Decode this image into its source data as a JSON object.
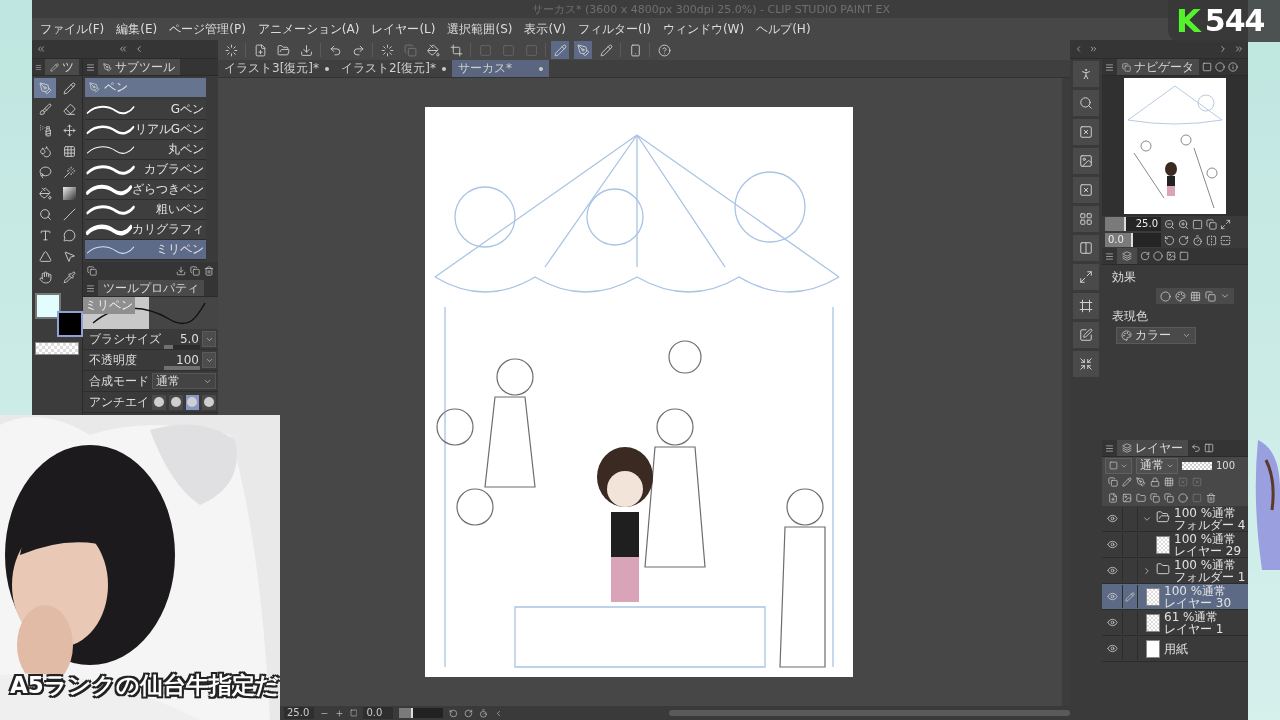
{
  "window": {
    "title": "サーカス* (3600 x 4800px 300dpi 25.0%) - CLIP STUDIO PAINT EX"
  },
  "menu": [
    "ファイル(F)",
    "編集(E)",
    "ページ管理(P)",
    "アニメーション(A)",
    "レイヤー(L)",
    "選択範囲(S)",
    "表示(V)",
    "フィルター(I)",
    "ウィンドウ(W)",
    "ヘルプ(H)"
  ],
  "tool_palette": {
    "tab": "ツ",
    "tools": [
      {
        "kind": "pen",
        "selected": true
      },
      {
        "kind": "pencil",
        "selected": false
      },
      {
        "kind": "brush",
        "selected": false
      },
      {
        "kind": "eraser",
        "selected": false
      },
      {
        "kind": "spray",
        "selected": false
      },
      {
        "kind": "move",
        "selected": false
      },
      {
        "kind": "blend",
        "selected": false
      },
      {
        "kind": "figure",
        "selected": false
      },
      {
        "kind": "lasso",
        "selected": false
      },
      {
        "kind": "wand",
        "selected": false
      },
      {
        "kind": "fill",
        "selected": false
      },
      {
        "kind": "gradient",
        "selected": false
      },
      {
        "kind": "operation",
        "selected": false
      },
      {
        "kind": "line",
        "selected": false
      },
      {
        "kind": "text",
        "selected": false
      },
      {
        "kind": "balloon",
        "selected": false
      },
      {
        "kind": "ruler",
        "selected": false
      },
      {
        "kind": "correct",
        "selected": false
      },
      {
        "kind": "hand",
        "selected": false
      },
      {
        "kind": "eyedropper",
        "selected": false
      }
    ],
    "colors": [
      {
        "color": "#e2fdfd",
        "selected": false
      },
      {
        "color": "#000000",
        "selected": true
      }
    ]
  },
  "sub_tool": {
    "title": "サブツール",
    "group": "ペン",
    "items": [
      {
        "label": "Gペン",
        "selected": false
      },
      {
        "label": "リアルGペン",
        "selected": false
      },
      {
        "label": "丸ペン",
        "selected": false
      },
      {
        "label": "カブラペン",
        "selected": false
      },
      {
        "label": "ざらつきペン",
        "selected": false
      },
      {
        "label": "粗いペン",
        "selected": false
      },
      {
        "label": "カリグラフィ",
        "selected": false
      },
      {
        "label": "ミリペン",
        "selected": true
      }
    ]
  },
  "tool_property": {
    "title": "ツールプロパティ",
    "preset": "ミリペン",
    "rows": [
      {
        "kind": "number",
        "label": "ブラシサイズ",
        "value": "5.0",
        "level": 0.25
      },
      {
        "kind": "number",
        "label": "不透明度",
        "value": "100",
        "level": 1
      },
      {
        "kind": "select",
        "label": "合成モード",
        "value": "通常"
      },
      {
        "kind": "options",
        "label": "アンチエイ",
        "options": [
          {
            "selected": false
          },
          {
            "selected": false
          },
          {
            "selected": true
          },
          {
            "selected": false
          }
        ]
      }
    ]
  },
  "document_tabs": [
    {
      "label": "イラスト3[復元]*",
      "selected": false
    },
    {
      "label": "イラスト2[復元]*",
      "selected": false
    },
    {
      "label": "サーカス*",
      "selected": true
    }
  ],
  "status_bar": {
    "zoom": "25.0",
    "angle": "0.0",
    "rotation_slider": {
      "level": 0.3
    }
  },
  "navigator": {
    "title": "ナビゲータ",
    "zoom_slider": {
      "value": "25.0",
      "level": 0.38
    },
    "rotation_slider": {
      "value": "0.0",
      "level": 0.5
    }
  },
  "layer_property": {
    "effect_label": "効果",
    "color_label": "表現色",
    "color_mode": "カラー"
  },
  "layers": {
    "title": "レイヤー",
    "blend_mode": "通常",
    "opacity": "100",
    "opacity_slider": {
      "level": 1
    },
    "items": [
      {
        "kind": "folder",
        "mode": "100 %通常",
        "name": "フォルダー 4",
        "visible": true,
        "selected": false,
        "expanded": true,
        "children": [
          {
            "kind": "layer",
            "mode": "100 %通常",
            "name": "レイヤー 29",
            "visible": true,
            "selected": false
          }
        ]
      },
      {
        "kind": "folder",
        "mode": "100 %通常",
        "name": "フォルダー 1",
        "visible": true,
        "selected": false,
        "expanded": false
      },
      {
        "kind": "layer",
        "mode": "100 %通常",
        "name": "レイヤー 30",
        "visible": true,
        "selected": true
      },
      {
        "kind": "layer",
        "mode": "61 %通常",
        "name": "レイヤー 1",
        "visible": true,
        "selected": false
      },
      {
        "kind": "paper",
        "name": "用紙",
        "visible": true,
        "selected": false
      }
    ]
  },
  "badge": {
    "logo": "K",
    "count": "544"
  },
  "caption": "A5ランクの仙台牛指定だ"
}
